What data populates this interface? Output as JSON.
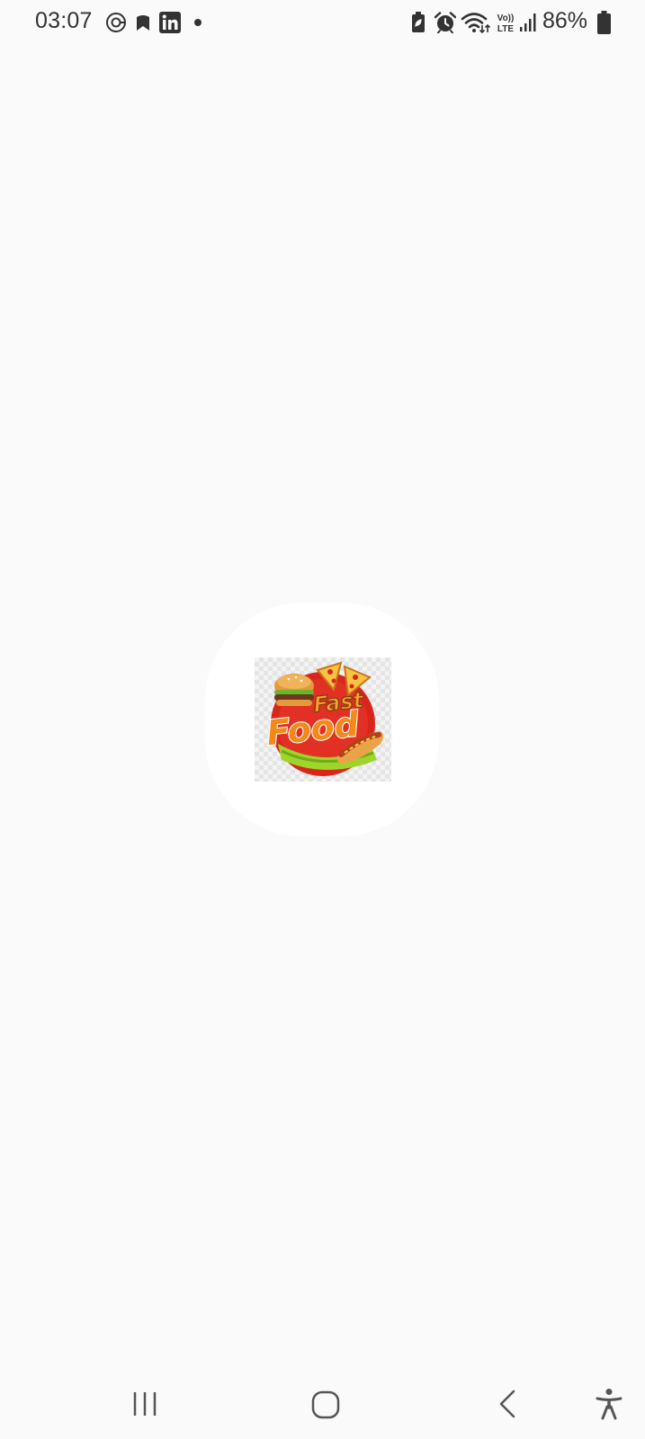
{
  "status_bar": {
    "time": "03:07",
    "battery_percent": "86%",
    "network_label_top": "Vo))",
    "network_label_bottom": "LTE",
    "left_icons": [
      "sync-circle-icon",
      "bookmark-icon",
      "linkedin-icon",
      "notification-dot-icon"
    ],
    "right_icons": [
      "battery-saver-icon",
      "alarm-icon",
      "wifi-icon",
      "volte-icon",
      "signal-icon",
      "battery-icon"
    ]
  },
  "splash": {
    "logo_text_line1": "Fast",
    "logo_text_line2": "Food"
  },
  "nav_bar": {
    "buttons": [
      "recents-icon",
      "home-icon",
      "back-icon",
      "accessibility-icon"
    ]
  },
  "colors": {
    "background": "#fafafa",
    "blob": "#ffffff",
    "logo_orange": "#f28a1a",
    "logo_red": "#d9261c",
    "logo_green": "#9fd42a",
    "icon_dark": "#333333"
  }
}
